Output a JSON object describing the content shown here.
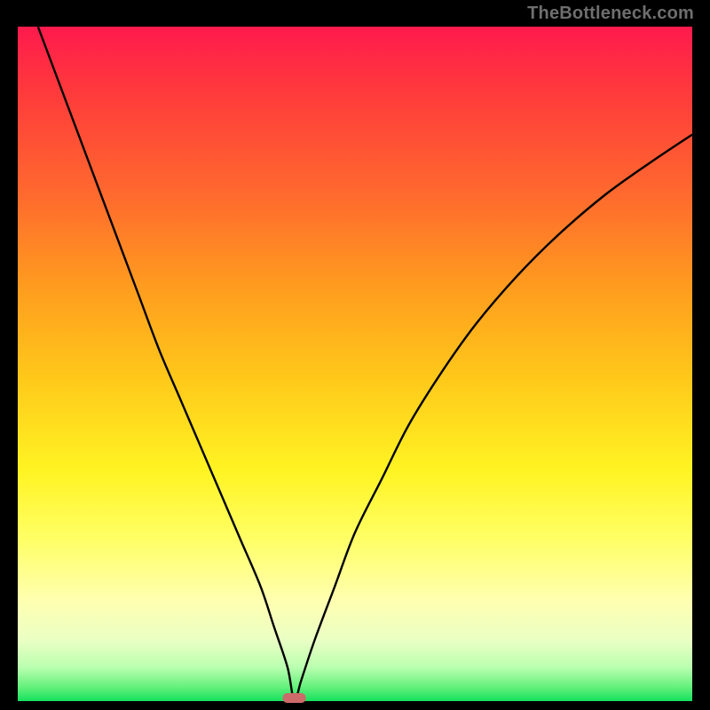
{
  "attribution": "TheBottleneck.com",
  "chart_data": {
    "type": "line",
    "title": "",
    "xlabel": "",
    "ylabel": "",
    "xlim": [
      0,
      100
    ],
    "ylim": [
      0,
      100
    ],
    "grid": false,
    "legend": false,
    "minimum_marker": {
      "x": 41,
      "y": 0
    },
    "series": [
      {
        "name": "bottleneck-curve",
        "x": [
          3,
          6,
          9,
          12,
          15,
          18,
          21,
          24,
          27,
          30,
          33,
          36,
          38,
          40,
          41,
          42,
          44,
          47,
          50,
          54,
          58,
          63,
          68,
          74,
          80,
          87,
          94,
          100
        ],
        "y": [
          100,
          92,
          84,
          76,
          68,
          60,
          52,
          45,
          38,
          31,
          24,
          17,
          11,
          5,
          0,
          3,
          9,
          17,
          25,
          33,
          41,
          49,
          56,
          63,
          69,
          75,
          80,
          84
        ]
      }
    ]
  },
  "colors": {
    "background": "#000000",
    "gradient_top": "#ff1a4d",
    "gradient_bottom": "#15e05e",
    "curve": "#000000",
    "marker": "#cd6a6a",
    "attribution_text": "#6e6e6e"
  }
}
